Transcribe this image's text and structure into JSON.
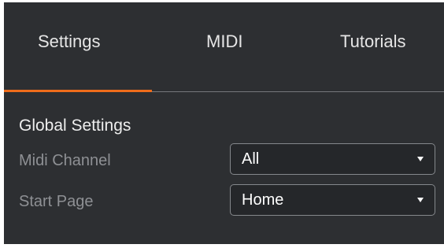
{
  "tabs": [
    {
      "label": "Settings",
      "active": true
    },
    {
      "label": "MIDI",
      "active": false
    },
    {
      "label": "Tutorials",
      "active": false
    }
  ],
  "colors": {
    "panel_background": "#2d2f32",
    "accent": "#ef6c1b",
    "label_text": "#8e9094",
    "value_text": "#ffffff"
  },
  "global_settings": {
    "title": "Global Settings",
    "midi_channel": {
      "label": "Midi Channel",
      "value": "All",
      "icon": "chevron-down-icon"
    },
    "start_page": {
      "label": "Start Page",
      "value": "Home",
      "icon": "chevron-down-icon"
    }
  }
}
